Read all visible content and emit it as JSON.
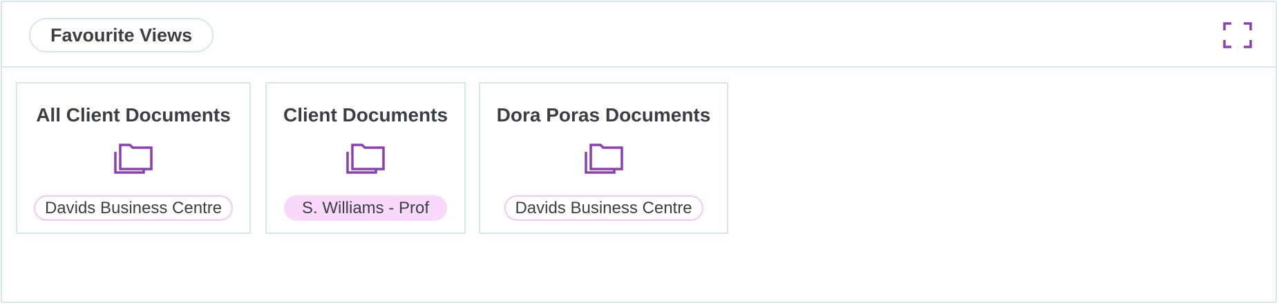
{
  "widget": {
    "title": "Favourite Views",
    "expand_icon": "expand-icon"
  },
  "colors": {
    "accent": "#8a3fb5",
    "border": "#d6e6f0",
    "tag_fill": "#f8d8fb",
    "tag_outline": "#f5c6f5",
    "text": "#3d3d44"
  },
  "cards": [
    {
      "title": "All Client Documents",
      "icon": "folders-icon",
      "tag": "Davids Business Centre",
      "tag_filled": false
    },
    {
      "title": "Client Documents",
      "icon": "folders-icon",
      "tag": "S. Williams - Prof",
      "tag_filled": true
    },
    {
      "title": "Dora Poras Documents",
      "icon": "folders-icon",
      "tag": "Davids Business Centre",
      "tag_filled": false
    }
  ]
}
